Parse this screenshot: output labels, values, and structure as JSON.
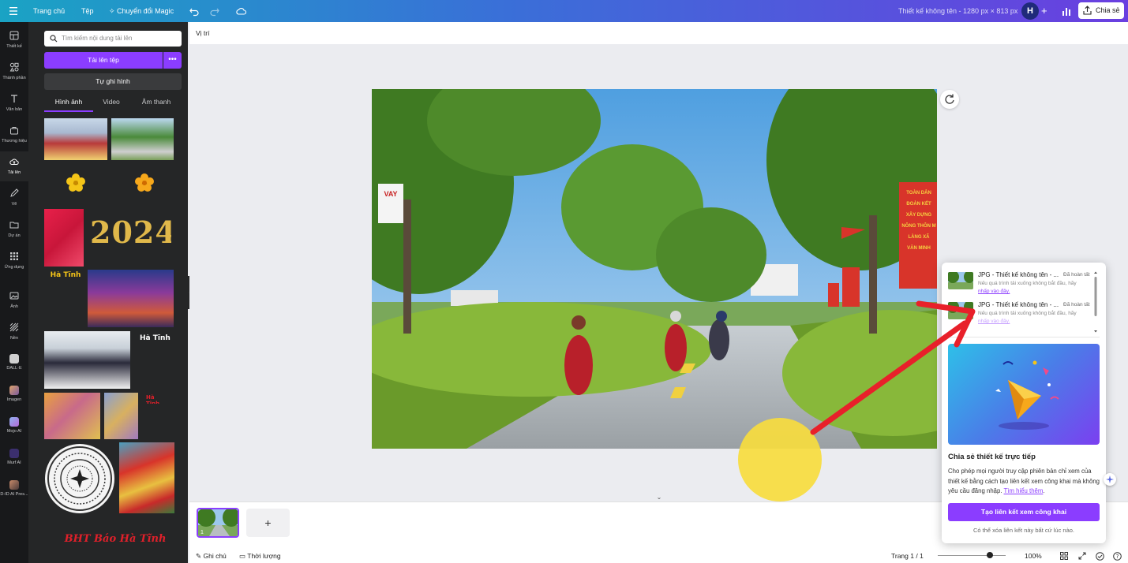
{
  "topbar": {
    "home": "Trang chủ",
    "file": "Tệp",
    "magic": "Chuyển đổi Magic",
    "title": "Thiết kế không tên - 1280 px × 813 px",
    "avatar": "H",
    "share": "Chia sẻ"
  },
  "nav": [
    {
      "label": "Thiết kế",
      "icon": "layout-icon"
    },
    {
      "label": "Thành phần",
      "icon": "elements-icon"
    },
    {
      "label": "Văn bản",
      "icon": "text-icon"
    },
    {
      "label": "Thương hiệu",
      "icon": "brand-icon"
    },
    {
      "label": "Tải lên",
      "icon": "upload-cloud-icon"
    },
    {
      "label": "Vẽ",
      "icon": "draw-icon"
    },
    {
      "label": "Dự án",
      "icon": "folder-icon"
    },
    {
      "label": "Ứng dụng",
      "icon": "apps-grid-icon"
    },
    {
      "label": "Ảnh",
      "icon": "photo-icon"
    },
    {
      "label": "Nền",
      "icon": "background-icon"
    },
    {
      "label": "DALL·E",
      "icon": "dalle-app-icon"
    },
    {
      "label": "Imagen",
      "icon": "imagen-app-icon"
    },
    {
      "label": "Mojo AI",
      "icon": "mojo-app-icon"
    },
    {
      "label": "Murf AI",
      "icon": "murf-app-icon"
    },
    {
      "label": "D-ID AI Pres...",
      "icon": "did-app-icon"
    }
  ],
  "panel": {
    "search_placeholder": "Tìm kiếm nội dung tải lên",
    "upload": "Tải lên tệp",
    "more": "•••",
    "record": "Tự ghi hình",
    "tabs": [
      "Hình ảnh",
      "Video",
      "Âm thanh"
    ],
    "thumb_texts": {
      "year": "2024",
      "brand1": "Hà Tĩnh",
      "brand2": "Hà Tĩnh",
      "brand3": "Hà Tĩnh",
      "brand_long": "BHT Báo Hà Tĩnh"
    }
  },
  "workspace": {
    "position": "Vị trí",
    "scene": {
      "sign_left": "VAY",
      "banner_right": [
        "TOÀN DÂN",
        "ĐOÀN KẾT",
        "XÂY DỰNG",
        "NÔNG THÔN M",
        "LÀNG XÃ",
        "VĂN MINH"
      ]
    }
  },
  "bottombar": {
    "page_num": "1",
    "add_page": "+",
    "notes": "Ghi chú",
    "duration": "Thời lượng",
    "page_indicator": "Trang 1 / 1",
    "zoom": "100%"
  },
  "popup": {
    "downloads": [
      {
        "title": "JPG - Thiết kế không tên - ...",
        "status": "Đã hoàn tất",
        "desc": "Nếu quá trình tải xuống không bắt đầu, hãy",
        "link": "nhấp vào đây."
      },
      {
        "title": "JPG - Thiết kế không tên - ...",
        "status": "Đã hoàn tất",
        "desc": "Nếu quá trình tải xuống không bắt đầu, hãy",
        "link": "nhấp vào đây."
      }
    ],
    "heading": "Chia sẻ thiết kế trực tiếp",
    "body": "Cho phép mọi người truy cập phiên bản chỉ xem của thiết kế bằng cách tạo liên kết xem công khai mà không yêu cầu đăng nhập.",
    "learn_more": "Tìm hiểu thêm",
    "button": "Tạo liên kết xem công khai",
    "footer": "Có thể xóa liên kết này bất cứ lúc nào."
  },
  "colors": {
    "accent": "#8b3dff",
    "annotation_arrow": "#e8202a",
    "annotation_dot": "#f7dc3e"
  }
}
